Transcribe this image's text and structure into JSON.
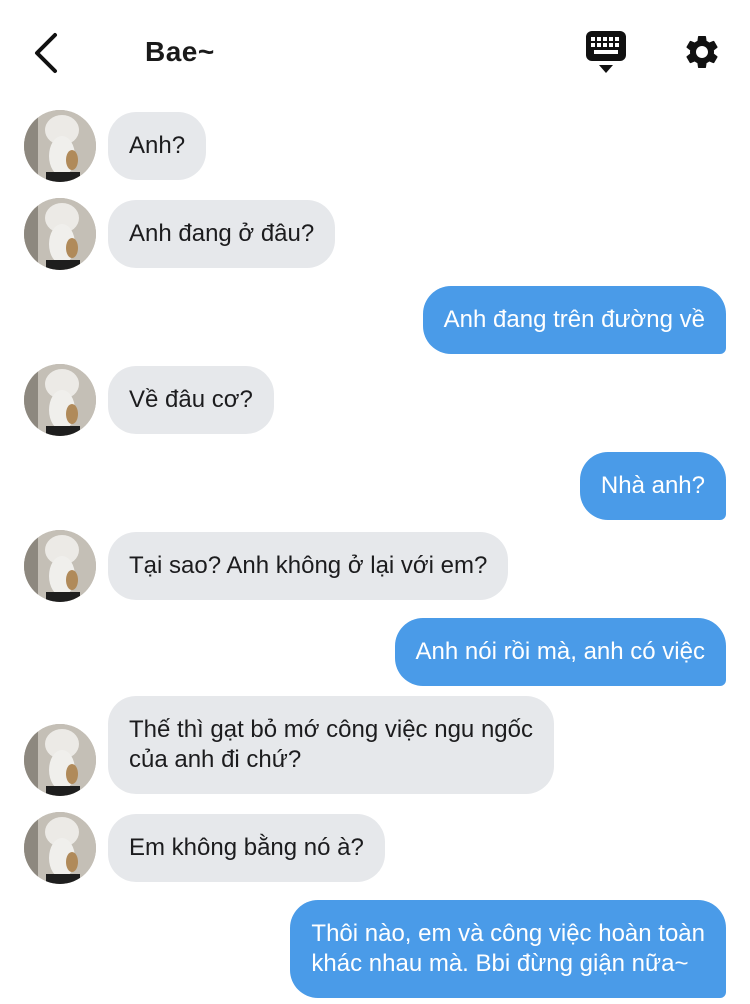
{
  "header": {
    "title": "Bae~",
    "back_icon": "chevron-left-icon",
    "keyboard_icon": "keyboard-icon",
    "settings_icon": "gear-icon"
  },
  "colors": {
    "incoming_bubble": "#e6e8eb",
    "outgoing_bubble": "#4a9be8",
    "outgoing_text": "#ffffff",
    "incoming_text": "#1c1c1e"
  },
  "messages": [
    {
      "from": "them",
      "text": "Anh?"
    },
    {
      "from": "them",
      "text": "Anh đang ở đâu?"
    },
    {
      "from": "me",
      "text": "Anh đang trên đường về"
    },
    {
      "from": "them",
      "text": "Về đâu cơ?"
    },
    {
      "from": "me",
      "text": "Nhà anh?"
    },
    {
      "from": "them",
      "text": "Tại sao? Anh không ở lại với em?"
    },
    {
      "from": "me",
      "text": "Anh nói rồi mà, anh có việc"
    },
    {
      "from": "them",
      "text": "Thế thì gạt bỏ mớ công việc ngu ngốc\ncủa anh đi chứ?"
    },
    {
      "from": "them",
      "text": "Em không bằng nó à?"
    },
    {
      "from": "me",
      "text": "Thôi nào, em và công việc hoàn toàn\nkhác nhau mà. Bbi đừng giận nữa~"
    }
  ]
}
